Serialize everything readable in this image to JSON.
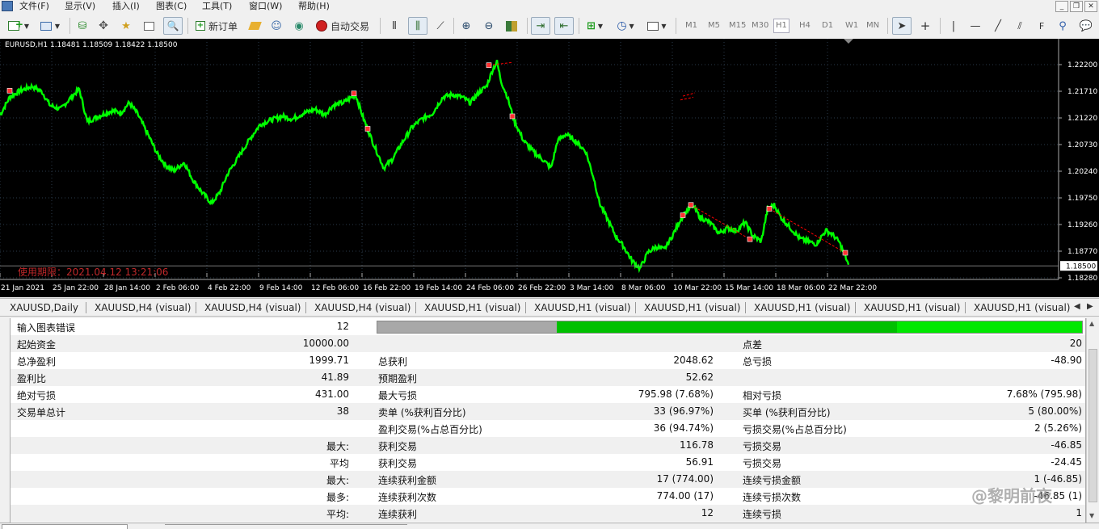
{
  "menubar": {
    "items": [
      "文件(F)",
      "显示(V)",
      "插入(I)",
      "图表(C)",
      "工具(T)",
      "窗口(W)",
      "帮助(H)"
    ]
  },
  "toolbar": {
    "new_order_label": "新订单",
    "auto_trade_label": "自动交易",
    "timeframes": [
      "M1",
      "M5",
      "M15",
      "M30",
      "H1",
      "H4",
      "D1",
      "W1",
      "MN"
    ],
    "selected_timeframe": "H1"
  },
  "chart": {
    "info": "EURUSD,H1  1.18481 1.18509 1.18422 1.18500",
    "expiry_text": "使用期限：2021.04.12 13:21:06",
    "current_price": "1.18500",
    "colors": {
      "background": "#000000",
      "price_line": "#00ff00",
      "grid": "#2a3a4a",
      "trade_line": "#ff0000",
      "text": "#ffffff"
    }
  },
  "chart_data": {
    "type": "line",
    "title": "EURUSD,H1",
    "y_ticks": [
      "1.22200",
      "1.21710",
      "1.21220",
      "1.20730",
      "1.20240",
      "1.19750",
      "1.19260",
      "1.18770",
      "1.18280"
    ],
    "x_ticks": [
      "21 Jan 2021",
      "25 Jan 22:00",
      "28 Jan 14:00",
      "2 Feb 06:00",
      "4 Feb 22:00",
      "9 Feb 14:00",
      "12 Feb 06:00",
      "16 Feb 22:00",
      "19 Feb 14:00",
      "24 Feb 06:00",
      "26 Feb 22:00",
      "3 Mar 14:00",
      "8 Mar 06:00",
      "10 Mar 22:00",
      "15 Mar 14:00",
      "18 Mar 06:00",
      "22 Mar 22:00"
    ],
    "ylim": [
      1.1828,
      1.2245
    ],
    "series": [
      {
        "values": [
          [
            0,
            1.2127
          ],
          [
            12,
            1.216
          ],
          [
            25,
            1.2172
          ],
          [
            40,
            1.218
          ],
          [
            52,
            1.217
          ],
          [
            62,
            1.2145
          ],
          [
            75,
            1.2138
          ],
          [
            88,
            1.216
          ],
          [
            98,
            1.2175
          ],
          [
            108,
            1.2115
          ],
          [
            122,
            1.2125
          ],
          [
            138,
            1.2135
          ],
          [
            150,
            1.2132
          ],
          [
            160,
            1.215
          ],
          [
            170,
            1.213
          ],
          [
            182,
            1.2095
          ],
          [
            195,
            1.2055
          ],
          [
            205,
            1.2035
          ],
          [
            215,
            1.2025
          ],
          [
            228,
            1.204
          ],
          [
            238,
            1.201
          ],
          [
            250,
            1.1985
          ],
          [
            262,
            1.1965
          ],
          [
            272,
            1.1985
          ],
          [
            282,
            1.202
          ],
          [
            295,
            1.205
          ],
          [
            310,
            1.2085
          ],
          [
            322,
            1.211
          ],
          [
            335,
            1.2118
          ],
          [
            350,
            1.2125
          ],
          [
            362,
            1.212
          ],
          [
            375,
            1.213
          ],
          [
            390,
            1.2138
          ],
          [
            402,
            1.2128
          ],
          [
            412,
            1.2145
          ],
          [
            425,
            1.215
          ],
          [
            440,
            1.2165
          ],
          [
            450,
            1.212
          ],
          [
            462,
            1.2075
          ],
          [
            475,
            1.203
          ],
          [
            485,
            1.2045
          ],
          [
            497,
            1.2075
          ],
          [
            510,
            1.2105
          ],
          [
            522,
            1.212
          ],
          [
            535,
            1.213
          ],
          [
            548,
            1.216
          ],
          [
            560,
            1.2165
          ],
          [
            572,
            1.216
          ],
          [
            582,
            1.215
          ],
          [
            592,
            1.2168
          ],
          [
            602,
            1.218
          ],
          [
            610,
            1.2212
          ],
          [
            615,
            1.2225
          ],
          [
            620,
            1.219
          ],
          [
            628,
            1.216
          ],
          [
            636,
            1.2118
          ],
          [
            648,
            1.208
          ],
          [
            660,
            1.206
          ],
          [
            672,
            1.2045
          ],
          [
            682,
            1.203
          ],
          [
            690,
            1.208
          ],
          [
            700,
            1.2092
          ],
          [
            712,
            1.208
          ],
          [
            725,
            1.206
          ],
          [
            735,
            1.201
          ],
          [
            742,
            1.1965
          ],
          [
            752,
            1.1935
          ],
          [
            762,
            1.1905
          ],
          [
            772,
            1.1885
          ],
          [
            782,
            1.186
          ],
          [
            792,
            1.1845
          ],
          [
            802,
            1.1875
          ],
          [
            812,
            1.1885
          ],
          [
            822,
            1.188
          ],
          [
            832,
            1.1905
          ],
          [
            842,
            1.1935
          ],
          [
            852,
            1.1955
          ],
          [
            858,
            1.196
          ],
          [
            866,
            1.194
          ],
          [
            878,
            1.193
          ],
          [
            890,
            1.191
          ],
          [
            900,
            1.192
          ],
          [
            912,
            1.1915
          ],
          [
            922,
            1.193
          ],
          [
            932,
            1.1905
          ],
          [
            942,
            1.1895
          ],
          [
            950,
            1.1955
          ],
          [
            958,
            1.1962
          ],
          [
            966,
            1.194
          ],
          [
            978,
            1.192
          ],
          [
            990,
            1.19
          ],
          [
            1000,
            1.1895
          ],
          [
            1010,
            1.189
          ],
          [
            1022,
            1.1915
          ],
          [
            1030,
            1.1908
          ],
          [
            1038,
            1.1895
          ],
          [
            1046,
            1.1868
          ],
          [
            1050,
            1.1852
          ]
        ]
      }
    ],
    "trade_marks": [
      [
        12,
        1.2172
      ],
      [
        438,
        1.2167
      ],
      [
        455,
        1.2102
      ],
      [
        605,
        1.2219
      ],
      [
        634,
        1.2125
      ],
      [
        845,
        1.1943
      ],
      [
        855,
        1.1962
      ],
      [
        928,
        1.1899
      ],
      [
        952,
        1.1955
      ],
      [
        1046,
        1.1874
      ]
    ],
    "trade_lines": [
      [
        [
          605,
          1.2219
        ],
        [
          634,
          1.2224
        ]
      ],
      [
        [
          855,
          1.1962
        ],
        [
          928,
          1.1899
        ]
      ],
      [
        [
          952,
          1.1955
        ],
        [
          1046,
          1.1874
        ]
      ],
      [
        [
          845,
          1.2162
        ],
        [
          860,
          1.2168
        ]
      ],
      [
        [
          842,
          1.2155
        ],
        [
          858,
          1.216
        ]
      ]
    ]
  },
  "tabs": [
    "XAUUSD,Daily",
    "XAUUSD,H4 (visual)",
    "XAUUSD,H4 (visual)",
    "XAUUSD,H4 (visual)",
    "XAUUSD,H1 (visual)",
    "XAUUSD,H1 (visual)",
    "XAUUSD,H1 (visual)",
    "XAUUSD,H1 (visual)",
    "XAUUSD,H1 (visual)",
    "XAUUSD,H1 (visual)"
  ],
  "report": {
    "progress": {
      "gray_fraction": 0.255,
      "green_fraction": 0.482,
      "light_fraction": 0.263,
      "colors": {
        "gray": "#a8a8a8",
        "green": "#00c000",
        "light": "#00e800"
      }
    },
    "rows": [
      {
        "c1": "输入图表错误",
        "c2": "12",
        "c3": "",
        "c4": "",
        "c5": "",
        "c6": ""
      },
      {
        "c1": "起始资金",
        "c2": "10000.00",
        "c3": "",
        "c4": "",
        "c5": "点差",
        "c6": "20"
      },
      {
        "c1": "总净盈利",
        "c2": "1999.71",
        "c3": "总获利",
        "c4": "2048.62",
        "c5": "总亏损",
        "c6": "-48.90"
      },
      {
        "c1": "盈利比",
        "c2": "41.89",
        "c3": "预期盈利",
        "c4": "52.62",
        "c5": "",
        "c6": ""
      },
      {
        "c1": "绝对亏损",
        "c2": "431.00",
        "c3": "最大亏损",
        "c4": "795.98 (7.68%)",
        "c5": "相对亏损",
        "c6": "7.68% (795.98)"
      },
      {
        "c1": "交易单总计",
        "c2": "38",
        "c3": "卖单 (%获利百分比)",
        "c4": "33 (96.97%)",
        "c5": "买单 (%获利百分比)",
        "c6": "5 (80.00%)"
      },
      {
        "c1": "",
        "c2": "",
        "c3": "盈利交易(%占总百分比)",
        "c4": "36 (94.74%)",
        "c5": "亏损交易(%占总百分比)",
        "c6": "2 (5.26%)"
      },
      {
        "c1": "",
        "c2": "最大:",
        "c3": "获利交易",
        "c4": "116.78",
        "c5": "亏损交易",
        "c6": "-46.85"
      },
      {
        "c1": "",
        "c2": "平均",
        "c3": "获利交易",
        "c4": "56.91",
        "c5": "亏损交易",
        "c6": "-24.45"
      },
      {
        "c1": "",
        "c2": "最大:",
        "c3": "连续获利金额",
        "c4": "17 (774.00)",
        "c5": "连续亏损金额",
        "c6": "1 (-46.85)"
      },
      {
        "c1": "",
        "c2": "最多:",
        "c3": "连续获利次数",
        "c4": "774.00 (17)",
        "c5": "连续亏损次数",
        "c6": "-46.85 (1)"
      },
      {
        "c1": "",
        "c2": "平均:",
        "c3": "连续获利",
        "c4": "12",
        "c5": "连续亏损",
        "c6": "1"
      }
    ]
  },
  "watermark": "@黎明前夜"
}
